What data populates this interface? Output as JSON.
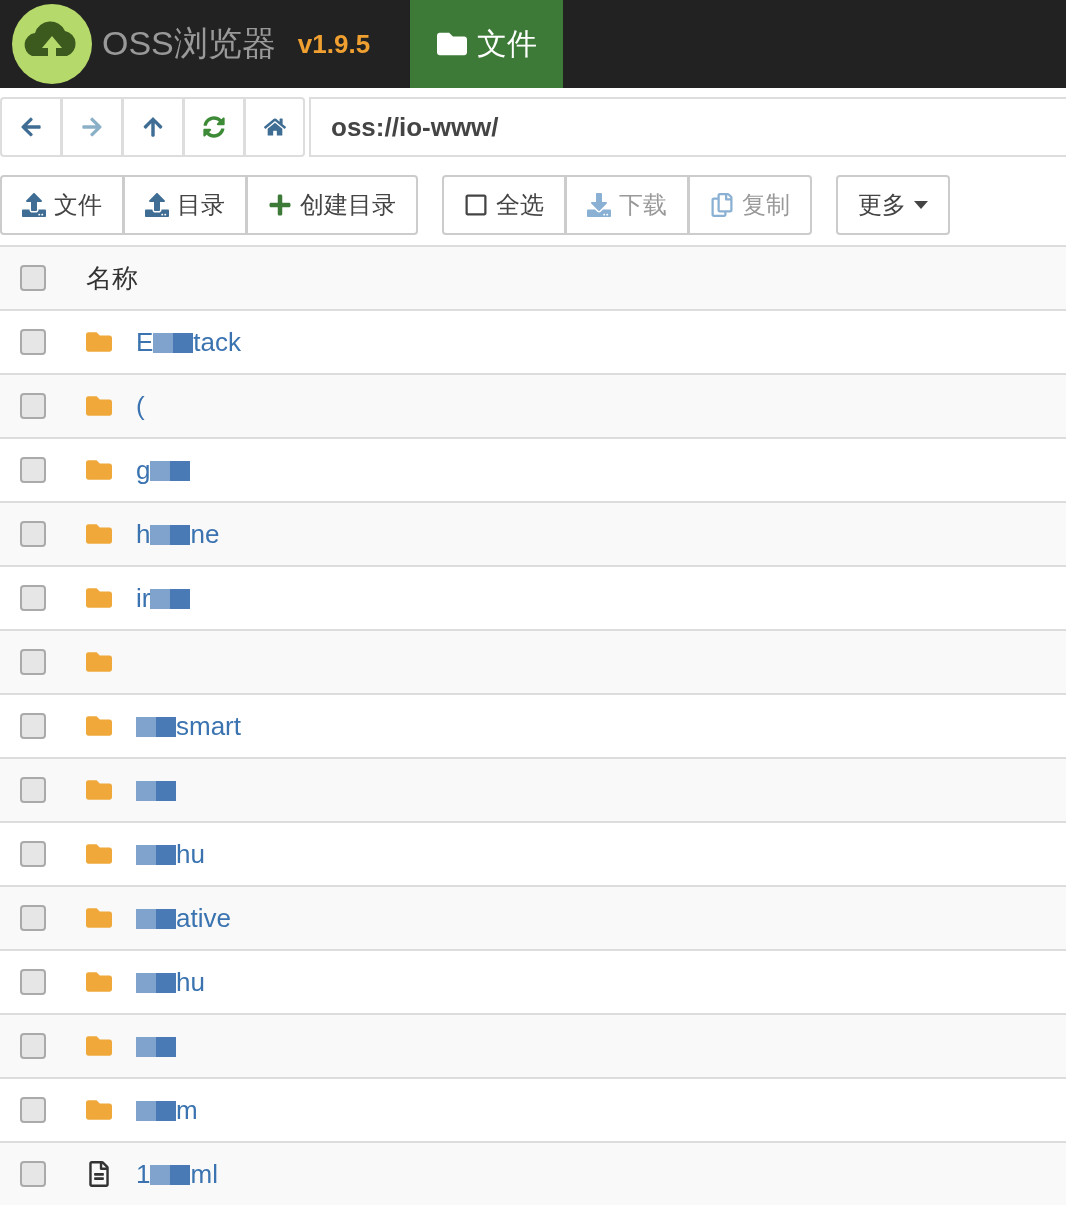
{
  "header": {
    "title": "OSS浏览器",
    "version": "v1.9.5",
    "tabs": [
      {
        "label": "文件",
        "selected": true
      }
    ]
  },
  "address": {
    "value": "oss://io-www/"
  },
  "toolbar": {
    "groups": [
      [
        {
          "kind": "upload",
          "label": "文件"
        },
        {
          "kind": "upload",
          "label": "目录"
        },
        {
          "kind": "plus",
          "label": "创建目录"
        }
      ],
      [
        {
          "kind": "square",
          "label": "全选",
          "disabled": false
        },
        {
          "kind": "download",
          "label": "下载",
          "disabled": true
        },
        {
          "kind": "copy",
          "label": "复制",
          "disabled": true
        }
      ],
      [
        {
          "kind": "caret",
          "label": "更多"
        }
      ]
    ]
  },
  "table": {
    "columns": [
      "名称"
    ],
    "select_all_checked": false,
    "rows": [
      {
        "kind": "folder",
        "checked": false,
        "before": "E",
        "after": "tack",
        "redacted": true
      },
      {
        "kind": "folder",
        "checked": false,
        "before": "(",
        "redacted": false
      },
      {
        "kind": "folder",
        "checked": false,
        "before": "g",
        "redacted": true
      },
      {
        "kind": "folder",
        "checked": false,
        "before": "h",
        "after": "ne",
        "redacted": true
      },
      {
        "kind": "folder",
        "checked": false,
        "before": "ir",
        "redacted": true
      },
      {
        "kind": "folder",
        "checked": false,
        "redacted": false
      },
      {
        "kind": "folder",
        "checked": false,
        "after": "smart",
        "redacted": true
      },
      {
        "kind": "folder",
        "checked": false,
        "redacted": true
      },
      {
        "kind": "folder",
        "checked": false,
        "after": "hu",
        "redacted": true
      },
      {
        "kind": "folder",
        "checked": false,
        "after": "ative",
        "redacted": true
      },
      {
        "kind": "folder",
        "checked": false,
        "after": "hu",
        "redacted": true
      },
      {
        "kind": "folder",
        "checked": false,
        "redacted": true
      },
      {
        "kind": "folder",
        "checked": false,
        "after": "m",
        "redacted": true
      },
      {
        "kind": "file",
        "checked": false,
        "before": "1",
        "after": "ml",
        "redacted": true
      }
    ]
  }
}
